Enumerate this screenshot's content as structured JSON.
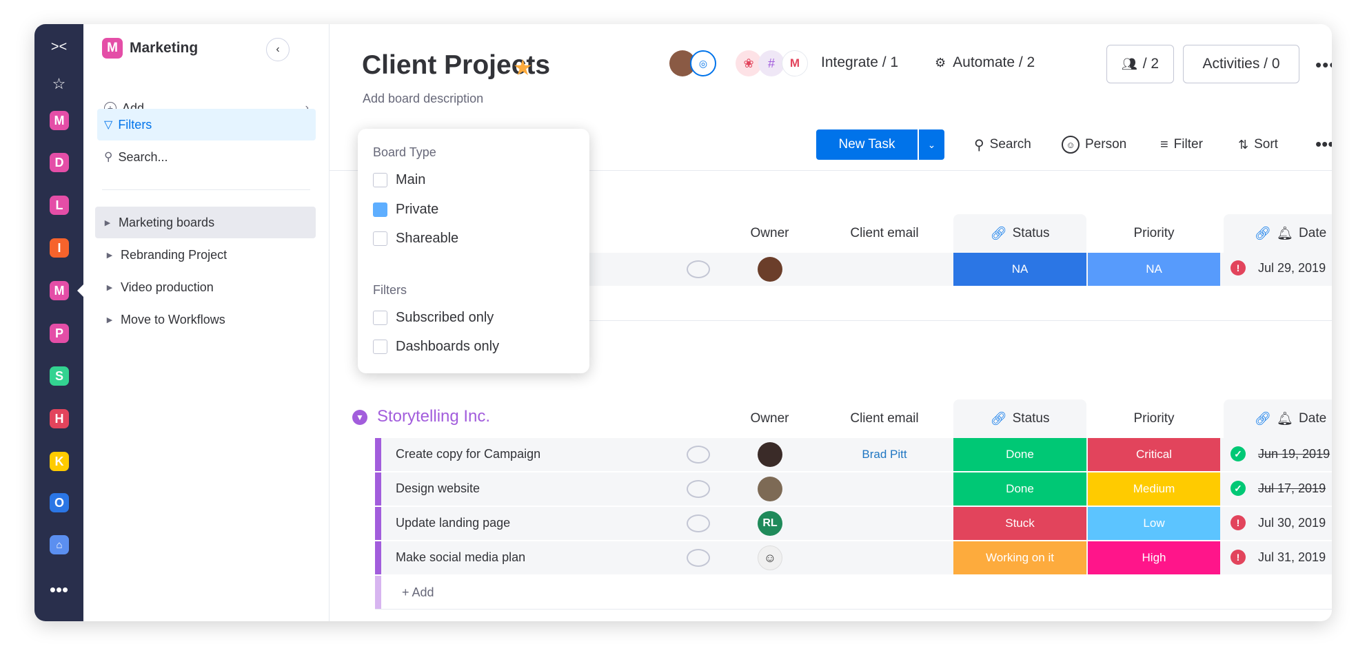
{
  "rail": {
    "workspaces": [
      {
        "letter": "M",
        "color": "#e44ea7"
      },
      {
        "letter": "D",
        "color": "#e44ea7"
      },
      {
        "letter": "L",
        "color": "#e44ea7"
      },
      {
        "letter": "I",
        "color": "#f6632c"
      },
      {
        "letter": "M",
        "color": "#e44ea7"
      },
      {
        "letter": "P",
        "color": "#e44ea7"
      },
      {
        "letter": "S",
        "color": "#33d391"
      },
      {
        "letter": "H",
        "color": "#e2445c"
      },
      {
        "letter": "K",
        "color": "#ffcb00"
      },
      {
        "letter": "O",
        "color": "#2b76e5"
      }
    ]
  },
  "sidebar": {
    "workspace_letter": "M",
    "workspace_name": "Marketing",
    "add_label": "Add",
    "filters_label": "Filters",
    "search_label": "Search...",
    "boards": [
      "Marketing boards",
      "Rebranding Project",
      "Video production",
      "Move to Workflows"
    ]
  },
  "filter_popup": {
    "board_type_title": "Board Type",
    "board_types": [
      {
        "label": "Main",
        "checked": false
      },
      {
        "label": "Private",
        "checked": true
      },
      {
        "label": "Shareable",
        "checked": false
      }
    ],
    "filters_title": "Filters",
    "filters": [
      {
        "label": "Subscribed only",
        "checked": false
      },
      {
        "label": "Dashboards only",
        "checked": false
      }
    ]
  },
  "header": {
    "title": "Client Projects",
    "description": "Add board description",
    "integrate": "Integrate / 1",
    "automate": "Automate / 2",
    "members": "/ 2",
    "activities": "Activities / 0"
  },
  "toolbar": {
    "new_task": "New Task",
    "search": "Search",
    "person": "Person",
    "filter": "Filter",
    "sort": "Sort"
  },
  "columns": {
    "owner": "Owner",
    "client_email": "Client email",
    "status": "Status",
    "priority": "Priority",
    "date": "Date"
  },
  "group1": {
    "row": {
      "status": "NA",
      "priority": "NA",
      "date": "Jul 29, 2019"
    }
  },
  "group2": {
    "name": "Storytelling Inc.",
    "add_row": "+ Add",
    "rows": [
      {
        "name": "Create copy for Campaign",
        "email": "Brad Pitt",
        "status": "Done",
        "priority": "Critical",
        "date": "Jun 19, 2019"
      },
      {
        "name": "Design website",
        "email": "",
        "status": "Done",
        "priority": "Medium",
        "date": "Jul 17, 2019"
      },
      {
        "name": "Update landing page",
        "email": "",
        "status": "Stuck",
        "priority": "Low",
        "date": "Jul 30, 2019",
        "owner_initials": "RL"
      },
      {
        "name": "Make social media plan",
        "email": "",
        "status": "Working on it",
        "priority": "High",
        "date": "Jul 31, 2019"
      }
    ]
  },
  "colors": {
    "accent": "#0073ea",
    "group_purple": "#a25ddc",
    "status_done": "#00c875",
    "status_stuck": "#e2445c",
    "status_working": "#fdab3d",
    "status_na": "#2b76e5",
    "priority_critical": "#e2445c",
    "priority_medium": "#ffcb00",
    "priority_low": "#5cc4ff",
    "priority_high": "#ff158a"
  }
}
